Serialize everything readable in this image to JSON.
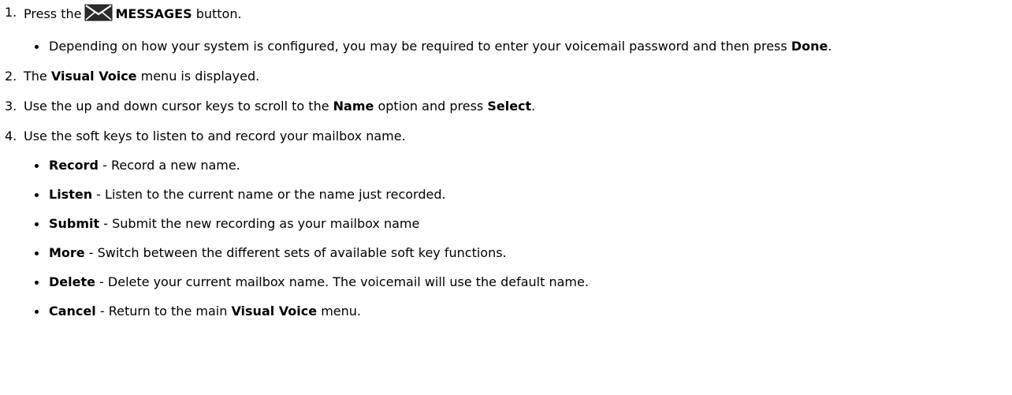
{
  "steps": [
    {
      "num": "1.",
      "a": "Press the",
      "icon": "envelope-icon",
      "b": "MESSAGES",
      "c": "button.",
      "sub": [
        {
          "a": "Depending on how your system is configured, you may be required to enter your voicemail password and then press",
          "b": "Done",
          "c": "."
        }
      ]
    },
    {
      "num": "2.",
      "a": "The",
      "b": "Visual Voice",
      "c": "menu is displayed."
    },
    {
      "num": "3.",
      "a": "Use the up and down cursor keys to scroll to the",
      "b": "Name",
      "c": "option and press",
      "d": "Select",
      "e": "."
    },
    {
      "num": "4.",
      "a": "Use the soft keys to listen to and record your mailbox name.",
      "sub": [
        {
          "b": "Record",
          "c": " - Record a new name."
        },
        {
          "b": "Listen",
          "c": " - Listen to the current name or the name just recorded."
        },
        {
          "b": "Submit",
          "c": " - Submit the new recording as your mailbox name"
        },
        {
          "b": "More",
          "c": " - Switch between the different sets of available soft key functions."
        },
        {
          "b": "Delete",
          "c": " - Delete your current mailbox name. The voicemail will use the default name."
        },
        {
          "b": "Cancel",
          "c": " - Return to the main",
          "d": "Visual Voice",
          "e": "menu."
        }
      ]
    }
  ]
}
